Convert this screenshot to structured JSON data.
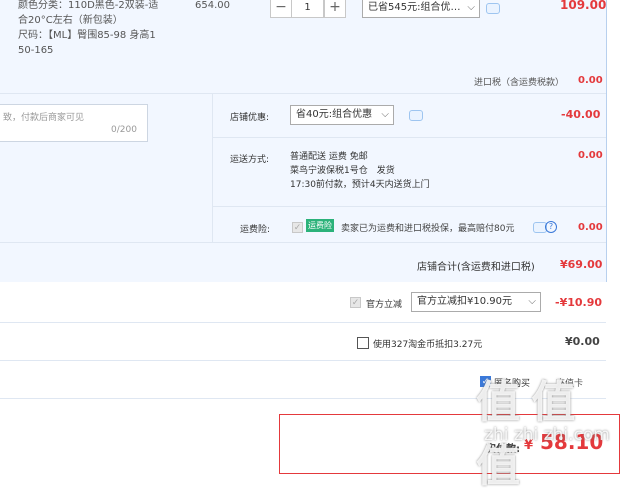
{
  "item": {
    "spec_color": "颜色分类：110D黑色-2双装-适",
    "spec_color_2": "合20°C左右（新包装）",
    "spec_size": "尺码：【ML】臀围85-98 身高1",
    "spec_size_2": "50-165",
    "unit_price": "654.00",
    "quantity": "1",
    "qty_minus": "−",
    "qty_plus": "+",
    "promo_select": "已省545元:组合优…",
    "subtotal": "109.00"
  },
  "import_tax": {
    "label": "进口税（含运费税款）",
    "value": "0.00"
  },
  "message_box": {
    "placeholder": "致，付款后商家可见",
    "counter": "0/200"
  },
  "shop_discount": {
    "label": "店铺优惠:",
    "select": "省40元:组合优惠",
    "value": "-40.00"
  },
  "shipping": {
    "label": "运送方式:",
    "line1": "普通配送 运费 免邮",
    "line2": "菜鸟宁波保税1号仓　发货",
    "line3": "17:30前付款，预计4天内送货上门",
    "value": "0.00"
  },
  "insurance": {
    "label": "运费险:",
    "badge": "运费险",
    "text": "卖家已为运费和进口税投保，最高赔付80元",
    "help": "?",
    "value": "0.00"
  },
  "shop_total": {
    "label": "店铺合计(含运费和进口税)",
    "value": "¥69.00"
  },
  "official_discount": {
    "label": "官方立减",
    "select": "官方立减扣¥10.90元",
    "value": "-¥10.90"
  },
  "coins": {
    "label": "使用327淘金币抵扣3.27元",
    "value": "¥0.00"
  },
  "anonymous": {
    "label": "匿名购买",
    "extra": "充值卡"
  },
  "pay": {
    "label": "实付款:",
    "currency": "¥",
    "amount": "58.10"
  },
  "watermark": {
    "text": "值 值 值",
    "url": "zhi zhi zhi.com"
  },
  "colors": {
    "accent_red": "#e4393c",
    "panel_blue": "#f2f7ff",
    "check_blue": "#3b79d9"
  }
}
